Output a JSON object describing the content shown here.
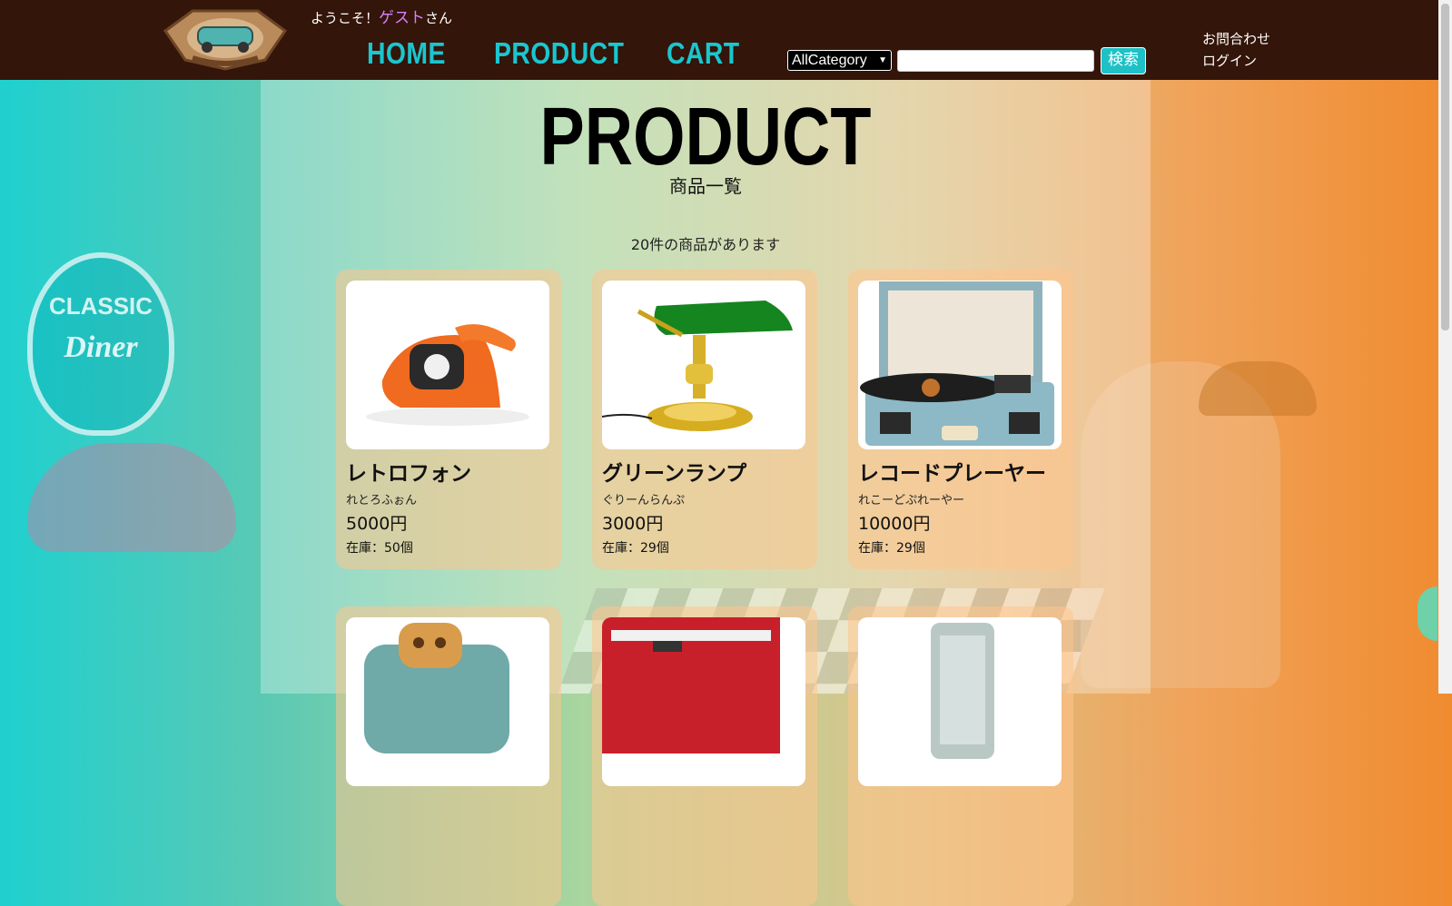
{
  "header": {
    "welcome_prefix": "ようこそ！",
    "guest_name": "ゲスト",
    "welcome_suffix": "さん",
    "nav": [
      {
        "label": "HOME"
      },
      {
        "label": "PRODUCT"
      },
      {
        "label": "CART"
      }
    ],
    "category_select": {
      "selected": "AllCategory"
    },
    "search": {
      "value": "",
      "button_label": "検索"
    },
    "contact_link": "お問合わせ",
    "login_link": "ログイン",
    "colors": {
      "bar": "#331509",
      "nav": "#1ac6cf",
      "guest": "#d580ff",
      "button": "#1ec1c6"
    },
    "logo_icon": "retro-car-badge-logo"
  },
  "main": {
    "title": "PRODUCT",
    "subtitle": "商品一覧",
    "result_count": "20件の商品があります",
    "products": [
      {
        "name": "レトロフォン",
        "kana": "れとろふぉん",
        "price": "5000円",
        "stock": "在庫：50個",
        "icon": "retro-phone-image"
      },
      {
        "name": "グリーンランプ",
        "kana": "ぐりーんらんぷ",
        "price": "3000円",
        "stock": "在庫：29個",
        "icon": "green-lamp-image"
      },
      {
        "name": "レコードプレーヤー",
        "kana": "れこーどぷれーやー",
        "price": "10000円",
        "stock": "在庫：29個",
        "icon": "record-player-image"
      },
      {
        "icon": "toaster-image"
      },
      {
        "icon": "coffee-maker-image"
      },
      {
        "icon": "mixer-image"
      }
    ]
  },
  "background": {
    "sign_top": "CLASSIC",
    "sign_bottom": "Diner"
  }
}
